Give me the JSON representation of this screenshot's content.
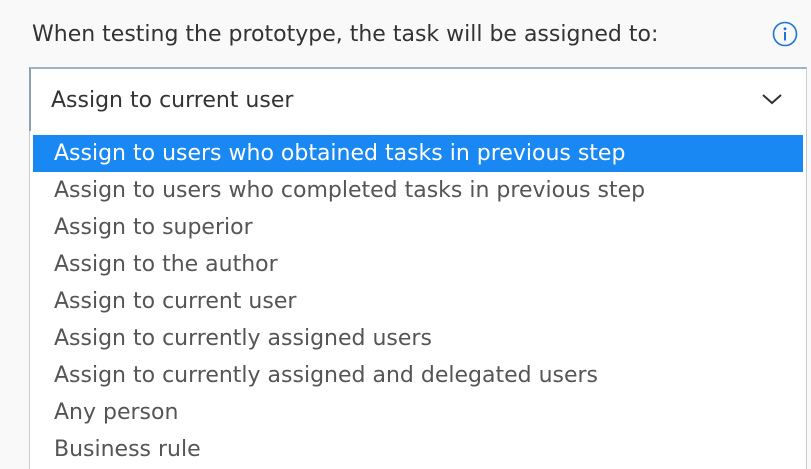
{
  "question_label": "When testing the prototype, the task will be assigned to:",
  "info_icon": "info-circle-icon",
  "select": {
    "current_value": "Assign to current user",
    "chevron_icon": "chevron-down-icon"
  },
  "options": [
    {
      "label": "Assign to users who obtained tasks in previous step",
      "highlighted": true
    },
    {
      "label": "Assign to users who completed tasks in previous step",
      "highlighted": false
    },
    {
      "label": "Assign to superior",
      "highlighted": false
    },
    {
      "label": "Assign to the author",
      "highlighted": false
    },
    {
      "label": "Assign to current user",
      "highlighted": false
    },
    {
      "label": "Assign to currently assigned users",
      "highlighted": false
    },
    {
      "label": "Assign to currently assigned and delegated users",
      "highlighted": false
    },
    {
      "label": "Any person",
      "highlighted": false
    },
    {
      "label": "Business rule",
      "highlighted": false
    }
  ],
  "colors": {
    "highlight": "#1a88f2",
    "info_icon": "#1a73d8",
    "text": "#333333",
    "option_text": "#555555"
  }
}
